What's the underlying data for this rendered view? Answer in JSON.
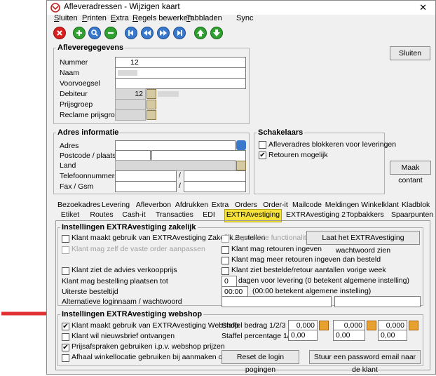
{
  "window": {
    "title": "Afleveradressen - Wijzigen kaart",
    "close": "✕"
  },
  "menu": [
    {
      "label": "Sluiten",
      "u": "S",
      "rest": "luiten"
    },
    {
      "label": "Printen",
      "u": "P",
      "rest": "rinten"
    },
    {
      "label": "Extra",
      "u": "E",
      "rest": "xtra"
    },
    {
      "label": "Regels bewerken",
      "u": "R",
      "rest": "egels bewerken"
    },
    {
      "label": "Tabbladen",
      "u": "T",
      "rest": "abbladen"
    },
    {
      "label": "Sync",
      "u": "",
      "rest": "Sync"
    }
  ],
  "toolbar": [
    "cancel-icon",
    "add-icon",
    "search-icon",
    "remove-icon",
    "first-icon",
    "previous-icon",
    "next-icon",
    "last-icon",
    "up-icon",
    "down-icon"
  ],
  "afleveregegevens": {
    "title": "Afleveregegevens",
    "nummer_label": "Nummer",
    "nummer_value": "12",
    "naam_label": "Naam",
    "naam_value": "",
    "voorvoegsel_label": "Voorvoegsel",
    "debiteur_label": "Debiteur",
    "debiteur_value": "12",
    "prijsgroep_label": "Prijsgroep",
    "reclame_label": "Reclame prijsgroep"
  },
  "sluiten_button": "Sluiten",
  "adres": {
    "title": "Adres informatie",
    "adres_label": "Adres",
    "postcode_label": "Postcode / plaats",
    "land_label": "Land",
    "tel_label": "Telefoonnummers",
    "fax_label": "Fax / Gsm",
    "slash": "/"
  },
  "schakelaars": {
    "title": "Schakelaars",
    "blokkeren": "Afleveradres blokkeren voor leveringen",
    "retouren": "Retouren mogelijk"
  },
  "maak_contant_button": "Maak contant",
  "tabs_row1": [
    "Bezoekadres",
    "Levering",
    "Afleverbon",
    "Afdrukken",
    "Extra",
    "Orders",
    "Order-it",
    "Mailcode",
    "Meldingen",
    "Winkelklant",
    "Kladblok"
  ],
  "tabs_row2": [
    "Etiket",
    "Routes",
    "Cash-it",
    "Transacties",
    "EDI",
    "EXTRAvestiging",
    "EXTRAvestiging 2",
    "Topbakkers",
    "Spaarpunten"
  ],
  "zakelijk": {
    "title": "Instellingen EXTRAvestiging zakelijk",
    "cb_zakelijk": "Klant maakt gebruik van EXTRAvestiging Zakelijk Bestellen",
    "cb_uitgebreid": "Uitgebreide functionaliteit",
    "wachtwoord_button": "Laat het EXTRAvestiging wachtwoord zien",
    "cb_vaste_order": "Klant mag zelf de vaste order aanpassen",
    "cb_retouren": "Klant mag retouren ingeven",
    "cb_meer_retouren": "Klant mag meer retouren ingeven dan besteld",
    "cb_advies": "Klant ziet de advies verkoopprijs",
    "cb_aantallen": "Klant ziet bestelde/retour aantallen vorige week",
    "bestelling_label": "Klant mag bestelling plaatsen tot",
    "dagen_value": "0",
    "dagen_text": "dagen voor levering (0 betekent algemene instelling)",
    "besteltijd_label": "Uiterste besteltijd",
    "tijd_value": "00:00",
    "tijd_text": "(00:00 betekent algemene instelling)",
    "login_label": "Alternatieve loginnaam / wachtwoord"
  },
  "webshop": {
    "title": "Instellingen EXTRAvestiging webshop",
    "cb_webshop": "Klant maakt gebruik van EXTRAvestiging Webshop",
    "cb_nieuwsbrief": "Klant wil nieuwsbrief ontvangen",
    "cb_prijsafspraken": "Prijsafspraken gebruiken i.p.v. webshop prijzen",
    "cb_afhaal": "Afhaal winkellocatie gebruiken bij aanmaken orders",
    "staffel_bedrag_label": "Staffel bedrag 1/2/3",
    "staffel_pct_label": "Staffel percentage 1/2/3",
    "bedrag_values": [
      "0,000",
      "0,000",
      "0,000"
    ],
    "pct_values": [
      "0,00",
      "0,00",
      "0,00"
    ],
    "reset_button": "Reset de login pogingen",
    "password_button": "Stuur een password email naar de klant"
  },
  "colors": {
    "active_tab": "#f5e23a",
    "arrow": "#e03030",
    "accent_blue": "#3377cc"
  }
}
